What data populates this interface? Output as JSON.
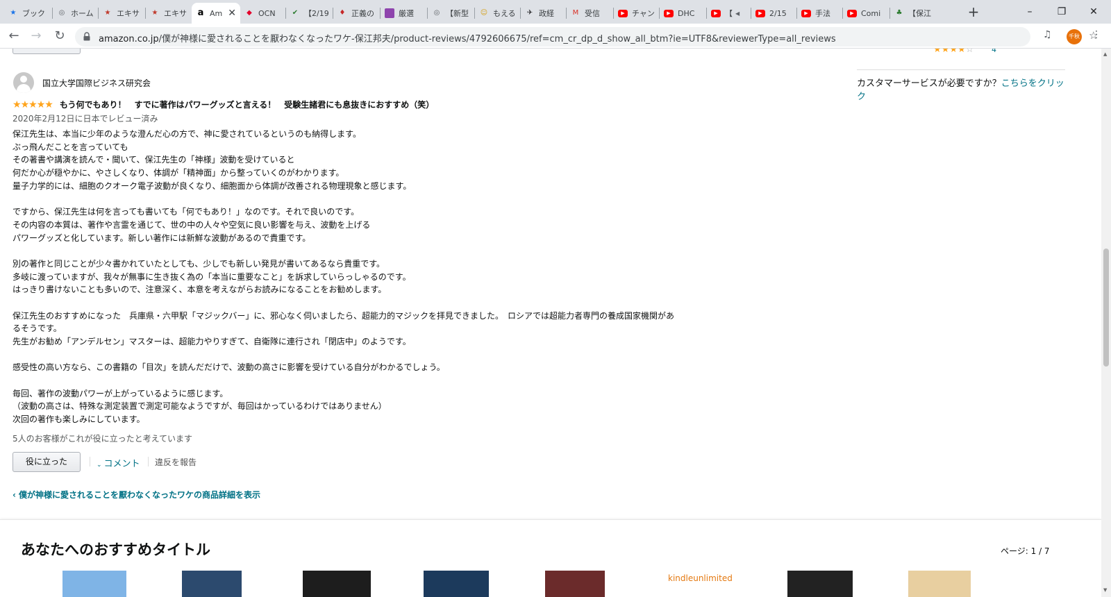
{
  "browser": {
    "tabs": [
      {
        "title": "ブック",
        "icon": "star-icon",
        "color": "#1a73e8"
      },
      {
        "title": "ホーム",
        "icon": "globe-icon",
        "color": "#5f6368"
      },
      {
        "title": "エキサ",
        "icon": "excite-icon",
        "color": "#c0392b"
      },
      {
        "title": "エキサ",
        "icon": "excite-icon",
        "color": "#c0392b"
      },
      {
        "title": "Ama",
        "icon": "amazon-icon",
        "color": "#000000",
        "active": true
      },
      {
        "title": "OCN",
        "icon": "ocn-icon",
        "color": "#e4002b"
      },
      {
        "title": "【2/19",
        "icon": "leaf-icon",
        "color": "#2e7d32"
      },
      {
        "title": "正義の",
        "icon": "figure-icon",
        "color": "#c62828"
      },
      {
        "title": "厳選",
        "icon": "square-icon",
        "color": "#8e44ad"
      },
      {
        "title": "【新型",
        "icon": "globe-icon",
        "color": "#5f6368"
      },
      {
        "title": "もえる",
        "icon": "character-icon",
        "color": "#d4a017"
      },
      {
        "title": "政経",
        "icon": "bird-icon",
        "color": "#202124"
      },
      {
        "title": "受信",
        "icon": "gmail-icon",
        "color": "#d93025"
      },
      {
        "title": "チャン",
        "icon": "youtube-icon",
        "color": "#ff0000"
      },
      {
        "title": "DHC",
        "icon": "youtube-icon",
        "color": "#ff0000"
      },
      {
        "title": "【",
        "icon": "youtube-icon",
        "color": "#ff0000",
        "audio": true
      },
      {
        "title": "2/15",
        "icon": "youtube-icon",
        "color": "#ff0000"
      },
      {
        "title": "手法",
        "icon": "youtube-icon",
        "color": "#ff0000"
      },
      {
        "title": "Comi",
        "icon": "youtube-icon",
        "color": "#ff0000"
      },
      {
        "title": "【保江",
        "icon": "frog-icon",
        "color": "#2e7d32"
      }
    ],
    "url_host": "amazon.co.jp",
    "url_path": "/僕が神様に愛されることを厭わなくなったワケ-保江邦夫/product-reviews/4792606675/ref=cm_cr_dp_d_show_all_btm?ie=UTF8&reviewerType=all_reviews",
    "profile_label": "千秋"
  },
  "review": {
    "reviewer_name": "国立大学国際ビジネス研究会",
    "rating": 5,
    "title": "もう何でもあり！　すでに著作はパワーグッズと言える！　受験生諸君にも息抜きにおすすめ（笑）",
    "date": "2020年2月12日に日本でレビュー済み",
    "body_lines": [
      "保江先生は、本当に少年のような澄んだ心の方で、神に愛されているというのも納得します。",
      "ぶっ飛んだことを言っていても",
      "その著書や講演を読んで・聞いて、保江先生の「神様」波動を受けていると",
      "何だか心が穏やかに、やさしくなり、体調が「精神面」から整っていくのがわかります。",
      "量子力学的には、細胞のクオーク電子波動が良くなり、細胞面から体調が改善される物理現象と感じます。",
      "",
      "ですから、保江先生は何を言っても書いても「何でもあり！」なのです。それで良いのです。",
      "その内容の本質は、著作や言霊を通じて、世の中の人々や空気に良い影響を与え、波動を上げる",
      "パワーグッズと化しています。新しい著作には新鮮な波動があるので貴重です。",
      "",
      "別の著作と同じことが少々書かれていたとしても、少しでも新しい発見が書いてあるなら貴重です。",
      "多岐に渡っていますが、我々が無事に生き抜く為の「本当に重要なこと」を訴求していらっしゃるのです。",
      "はっきり書けないことも多いので、注意深く、本意を考えながらお読みになることをお勧めします。",
      "",
      "保江先生のおすすめになった　兵庫県・六甲駅「マジックバー」に、邪心なく伺いましたら、超能力的マジックを拝見できました。　ロシアでは超能力者専門の養成国家機関があ",
      "るそうです。",
      "先生がお勧め「アンデルセン」マスターは、超能力やりすぎて、自衛隊に連行され「閉店中」のようです。",
      "",
      "感受性の高い方なら、この書籍の「目次」を読んだだけで、波動の高さに影響を受けている自分がわかるでしょう。",
      "",
      "毎回、著作の波動パワーが上がっているように感じます。",
      "（波動の高さは、特殊な測定装置で測定可能なようですが、毎回はかっているわけではありません）",
      "次回の著作も楽しみにしています。"
    ],
    "helpful_count_text": "5人のお客様がこれが役に立ったと考えています",
    "helpful_button": "役に立った",
    "comment_link": "コメント",
    "report_link": "違反を報告"
  },
  "back_link": "僕が神様に愛されることを厭わなくなったワケの商品詳細を表示",
  "sidebar": {
    "rating_stars": 4,
    "rating_count": "4",
    "cs_text": "カスタマーサービスが必要ですか？",
    "cs_link": "こちらをクリック"
  },
  "recommendations": {
    "title": "あなたへのおすすめタイトル",
    "page_label": "ページ: 1 / 7",
    "books": [
      {
        "color": "#7fb4e6"
      },
      {
        "color": "#2c4a6e"
      },
      {
        "color": "#1d1d1d"
      },
      {
        "color": "#1c3a5c"
      },
      {
        "color": "#6b2b2b"
      },
      {
        "color": "#ffffff",
        "label": "kindleunlimited"
      },
      {
        "color": "#222222"
      },
      {
        "color": "#e8cfa0"
      }
    ]
  }
}
